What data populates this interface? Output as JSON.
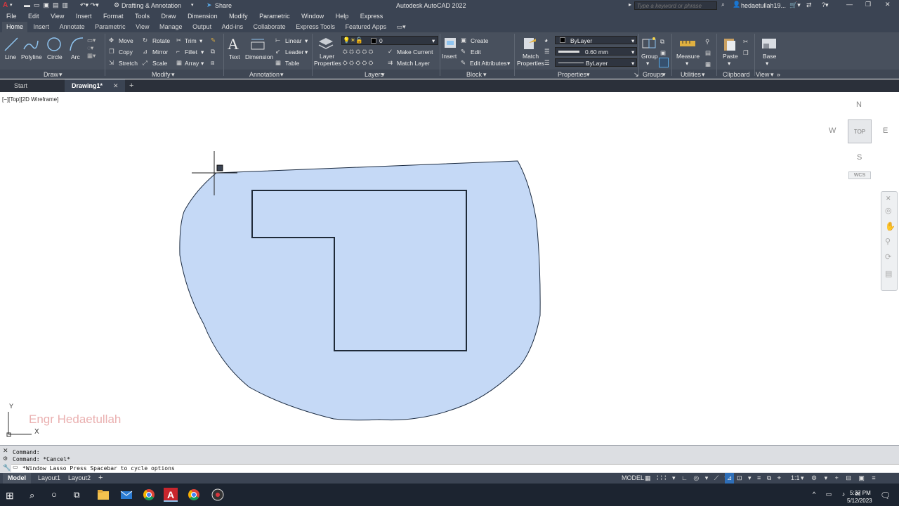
{
  "app": {
    "title": "Autodesk AutoCAD 2022",
    "workspace": "Drafting & Annotation",
    "share": "Share"
  },
  "search": {
    "placeholder": "Type a keyword or phrase"
  },
  "user": {
    "name": "hedaetullah19..."
  },
  "menu": [
    "File",
    "Edit",
    "View",
    "Insert",
    "Format",
    "Tools",
    "Draw",
    "Dimension",
    "Modify",
    "Parametric",
    "Window",
    "Help",
    "Express"
  ],
  "ribbon_tabs": [
    "Home",
    "Insert",
    "Annotate",
    "Parametric",
    "View",
    "Manage",
    "Output",
    "Add-ins",
    "Collaborate",
    "Express Tools",
    "Featured Apps"
  ],
  "draw": {
    "line": "Line",
    "polyline": "Polyline",
    "circle": "Circle",
    "arc": "Arc",
    "label": "Draw"
  },
  "modify": {
    "move": "Move",
    "rotate": "Rotate",
    "trim": "Trim",
    "copy": "Copy",
    "mirror": "Mirror",
    "fillet": "Fillet",
    "stretch": "Stretch",
    "scale": "Scale",
    "array": "Array",
    "label": "Modify"
  },
  "annotation": {
    "text": "Text",
    "dimension": "Dimension",
    "linear": "Linear",
    "leader": "Leader",
    "table": "Table",
    "label": "Annotation"
  },
  "layers": {
    "layer_properties_1": "Layer",
    "layer_properties_2": "Properties",
    "current_layer": "0",
    "make_current": "Make Current",
    "match_layer": "Match Layer",
    "label": "Layers"
  },
  "block": {
    "insert": "Insert",
    "create": "Create",
    "edit": "Edit",
    "edit_attributes": "Edit Attributes",
    "label": "Block"
  },
  "properties": {
    "match_1": "Match",
    "match_2": "Properties",
    "color": "ByLayer",
    "lineweight": "0.60 mm",
    "linetype": "ByLayer",
    "label": "Properties"
  },
  "groups": {
    "group": "Group",
    "label": "Groups"
  },
  "utilities": {
    "measure": "Measure",
    "label": "Utilities"
  },
  "clipboard": {
    "paste": "Paste",
    "label": "Clipboard"
  },
  "view": {
    "base": "Base",
    "label": "View"
  },
  "doc_tabs": {
    "start": "Start",
    "drawing": "Drawing1*"
  },
  "viewport": {
    "label": "[−][Top][2D Wireframe]"
  },
  "viewcube": {
    "n": "N",
    "s": "S",
    "e": "E",
    "w": "W",
    "top": "TOP",
    "wcs": "WCS"
  },
  "ucs": {
    "x": "X",
    "y": "Y"
  },
  "watermark": "Engr Hedaetullah",
  "command": {
    "line1": "Command:",
    "line2": "Command: *Cancel*",
    "prompt": "*Window Lasso  Press Spacebar to cycle options"
  },
  "layout_tabs": [
    "Model",
    "Layout1",
    "Layout2"
  ],
  "status": {
    "model": "MODEL",
    "scale": "1:1"
  },
  "clock": {
    "time": "5:37 PM",
    "date": "5/12/2023"
  },
  "colors": {
    "lasso_fill": "#c5d9f6",
    "ribbon": "#48505d",
    "titlebar": "#3b4453"
  }
}
